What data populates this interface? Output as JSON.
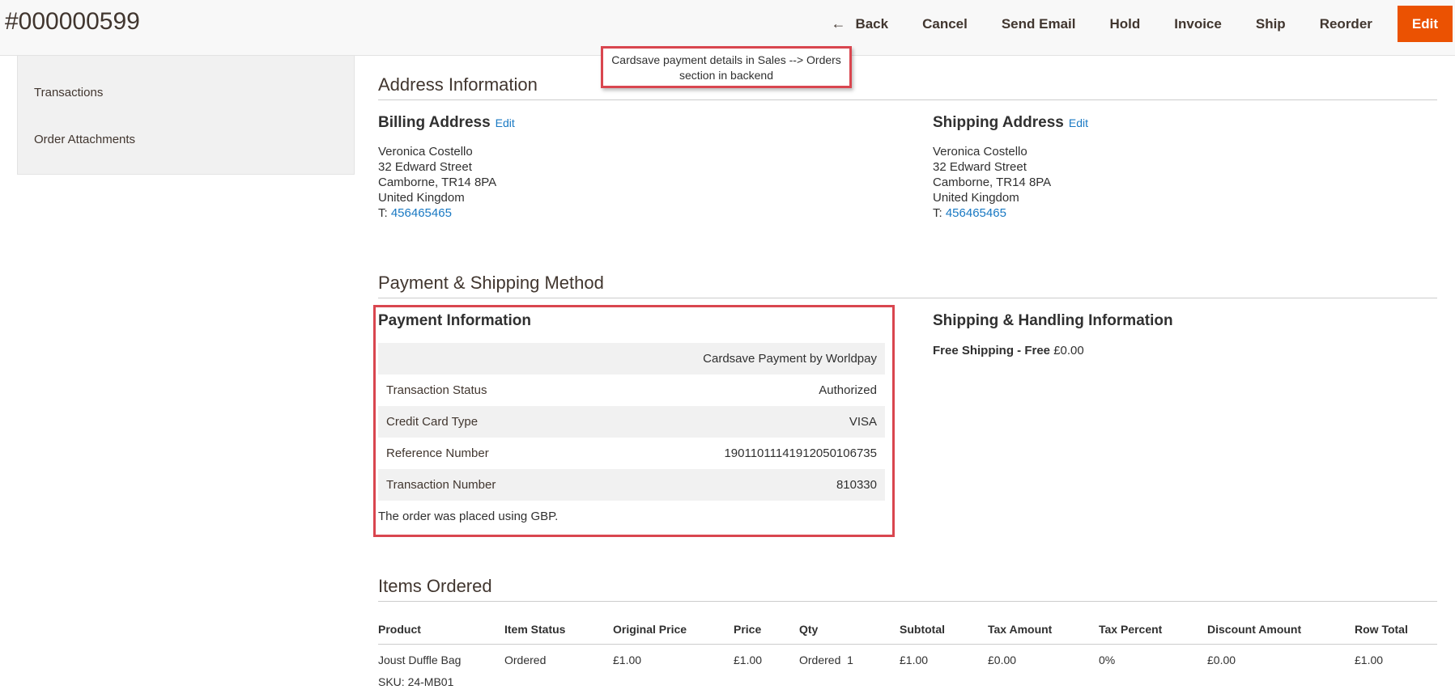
{
  "header": {
    "order_number": "#000000599",
    "actions": {
      "back": "Back",
      "cancel": "Cancel",
      "send_email": "Send Email",
      "hold": "Hold",
      "invoice": "Invoice",
      "ship": "Ship",
      "reorder": "Reorder",
      "edit": "Edit"
    }
  },
  "annotation": {
    "line1": "Cardsave payment details in Sales --> Orders",
    "line2": "section in backend"
  },
  "sidebar": {
    "items": [
      {
        "label": "Transactions"
      },
      {
        "label": "Order Attachments"
      }
    ]
  },
  "address_section": {
    "title": "Address Information",
    "billing": {
      "title": "Billing Address",
      "edit": "Edit",
      "name": "Veronica Costello",
      "street": "32 Edward Street",
      "city": "Camborne, TR14 8PA",
      "country": "United Kingdom",
      "phone_prefix": "T: ",
      "phone": "456465465"
    },
    "shipping": {
      "title": "Shipping Address",
      "edit": "Edit",
      "name": "Veronica Costello",
      "street": "32 Edward Street",
      "city": "Camborne, TR14 8PA",
      "country": "United Kingdom",
      "phone_prefix": "T: ",
      "phone": "456465465"
    }
  },
  "payment_section": {
    "title": "Payment & Shipping Method",
    "payment": {
      "title": "Payment Information",
      "method": "Cardsave Payment by Worldpay",
      "rows": [
        {
          "label": "Transaction Status",
          "value": "Authorized"
        },
        {
          "label": "Credit Card Type",
          "value": "VISA"
        },
        {
          "label": "Reference Number",
          "value": "19011011141912050106735"
        },
        {
          "label": "Transaction Number",
          "value": "810330"
        }
      ],
      "currency_note": "The order was placed using GBP."
    },
    "shipping": {
      "title": "Shipping & Handling Information",
      "method": "Free Shipping - Free",
      "price": " £0.00"
    }
  },
  "items_section": {
    "title": "Items Ordered",
    "columns": [
      "Product",
      "Item Status",
      "Original Price",
      "Price",
      "Qty",
      "Subtotal",
      "Tax Amount",
      "Tax Percent",
      "Discount Amount",
      "Row Total"
    ],
    "rows": [
      {
        "product": "Joust Duffle Bag",
        "sku": "SKU: 24-MB01",
        "item_status": "Ordered",
        "original_price": "£1.00",
        "price": "£1.00",
        "qty": "Ordered  1",
        "subtotal": "£1.00",
        "tax_amount": "£0.00",
        "tax_percent": "0%",
        "discount_amount": "£0.00",
        "row_total": "£1.00"
      }
    ]
  },
  "colors": {
    "accent": "#eb5202",
    "link": "#1979c3",
    "highlight_border": "#d9464f"
  }
}
